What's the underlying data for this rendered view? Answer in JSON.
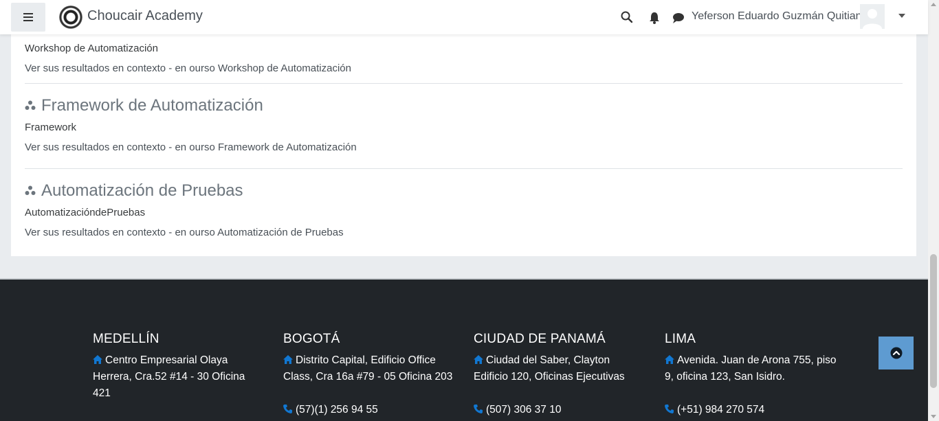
{
  "header": {
    "site_name": "Choucair Academy",
    "user_name": "Yeferson Eduardo Guzmán Quitian",
    "icons": [
      "menu-icon",
      "search-icon",
      "bell-icon",
      "chat-icon",
      "caret-down-icon"
    ]
  },
  "results": [
    {
      "title": "",
      "summary": "Workshop de Automatización",
      "context": "Ver sus resultados en contexto - en ourso Workshop de Automatización"
    },
    {
      "title": "Framework de Automatización",
      "summary": "Framework",
      "context": "Ver sus resultados en contexto - en ourso Framework de Automatización"
    },
    {
      "title": "Automatización de Pruebas",
      "summary": "AutomatizacióndePruebas",
      "context": "Ver sus resultados en contexto - en ourso Automatización de Pruebas"
    }
  ],
  "footer": {
    "offices": [
      {
        "city": "MEDELLÍN",
        "address": "Centro Empresarial Olaya Herrera, Cra.52 #14 - 30 Oficina 421",
        "phone": ""
      },
      {
        "city": "BOGOTÁ",
        "address": "Distrito Capital, Edificio Office Class, Cra 16a #79 - 05 Oficina 203",
        "phone": "(57)(1) 256 94 55"
      },
      {
        "city": "CIUDAD DE PANAMÁ",
        "address": "Ciudad del Saber, Clayton Edificio 120, Oficinas Ejecutivas",
        "phone": "(507) 306 37 10"
      },
      {
        "city": "LIMA",
        "address": "Avenida. Juan de Arona 755, piso 9, oficina 123, San Isidro.",
        "phone": "(+51) 984 270 574"
      }
    ]
  },
  "colors": {
    "accent": "#1177d1",
    "footer_bg": "#212529",
    "back_to_top": "#5e9bd1"
  }
}
